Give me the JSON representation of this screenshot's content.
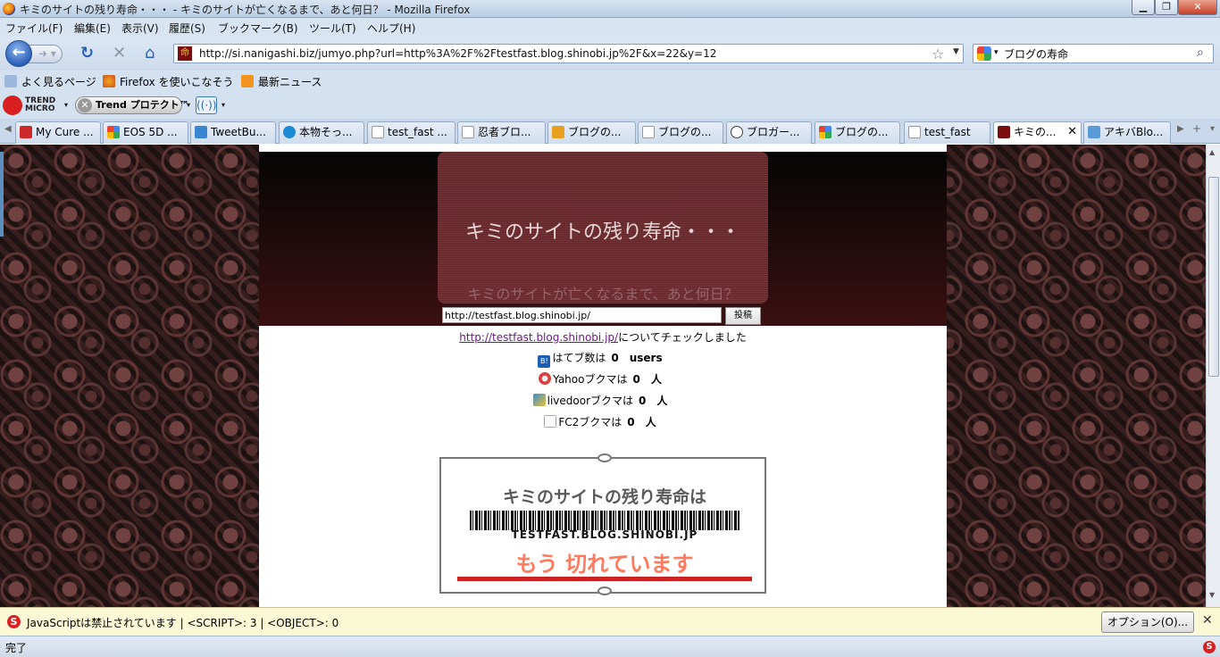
{
  "window": {
    "title": "キミのサイトの残り寿命・・・ - キミのサイトが亡くなるまで、あと何日？ - Mozilla Firefox"
  },
  "menu": [
    "ファイル(F)",
    "編集(E)",
    "表示(V)",
    "履歴(S)",
    "ブックマーク(B)",
    "ツール(T)",
    "ヘルプ(H)"
  ],
  "nav": {
    "url": "http://si.nanigashi.biz/jumyo.php?url=http%3A%2F%2Ftestfast.blog.shinobi.jp%2F&x=22&y=12",
    "search_value": "ブログの寿命"
  },
  "bookmarks": [
    "よく見るページ",
    "Firefox を使いこなそう",
    "最新ニュース"
  ],
  "trend": {
    "logo_line1": "TREND",
    "logo_line2": "MICRO",
    "protect_label": "Trend プロテクト™"
  },
  "tabs": [
    {
      "label": "My Cure ...",
      "color": "#cc2a2a"
    },
    {
      "label": "EOS 5D ...",
      "color": "#4285f4"
    },
    {
      "label": "TweetBu...",
      "color": "#3a86d0"
    },
    {
      "label": "本物そっ...",
      "color": "#1d8ad6"
    },
    {
      "label": "test_fast ...",
      "color": "#ffffff"
    },
    {
      "label": "忍者ブロ...",
      "color": "#ffffff"
    },
    {
      "label": "ブログの...",
      "color": "#e8a020"
    },
    {
      "label": "ブログの...",
      "color": "#ffffff"
    },
    {
      "label": "ブロガー...",
      "color": "#444444"
    },
    {
      "label": "ブログの...",
      "color": "#4285f4"
    },
    {
      "label": "test_fast",
      "color": "#ffffff"
    },
    {
      "label": "キミの...",
      "color": "#7a0d0d"
    },
    {
      "label": "アキバBlo...",
      "color": "#5a9ad8"
    }
  ],
  "page": {
    "header_title": "キミのサイトの残り寿命・・・",
    "header_subtitle": "キミのサイトが亡くなるまで、あと何日？",
    "url_input_value": "http://testfast.blog.shinobi.jp/",
    "post_button": "投稿",
    "checked_link": "http://testfast.blog.shinobi.jp/",
    "checked_suffix": "についてチェックしました",
    "results": [
      {
        "label": "はてブ数は",
        "count": "0",
        "unit": "users",
        "icon": "hatena-icon",
        "color": "#1a5fb4"
      },
      {
        "label": "Yahooブクマは",
        "count": "0",
        "unit": "人",
        "icon": "yahoo-icon",
        "color": "#e04040"
      },
      {
        "label": "livedoorブクマは",
        "count": "0",
        "unit": "人",
        "icon": "livedoor-icon",
        "color": "#3a8fd0"
      },
      {
        "label": "FC2ブクマは",
        "count": "0",
        "unit": "人",
        "icon": "fc2-icon",
        "color": "#bbbbbb"
      }
    ],
    "ticket": {
      "title": "キミのサイトの残り寿命は",
      "domain": "TESTFAST.BLOG.SHINOBI.JP",
      "status": "もう 切れています"
    }
  },
  "notification": {
    "message": "JavaScriptは禁止されています | <SCRIPT>: 3 | <OBJECT>: 0",
    "options_button": "オプション(O)..."
  },
  "status": {
    "text": "完了"
  }
}
